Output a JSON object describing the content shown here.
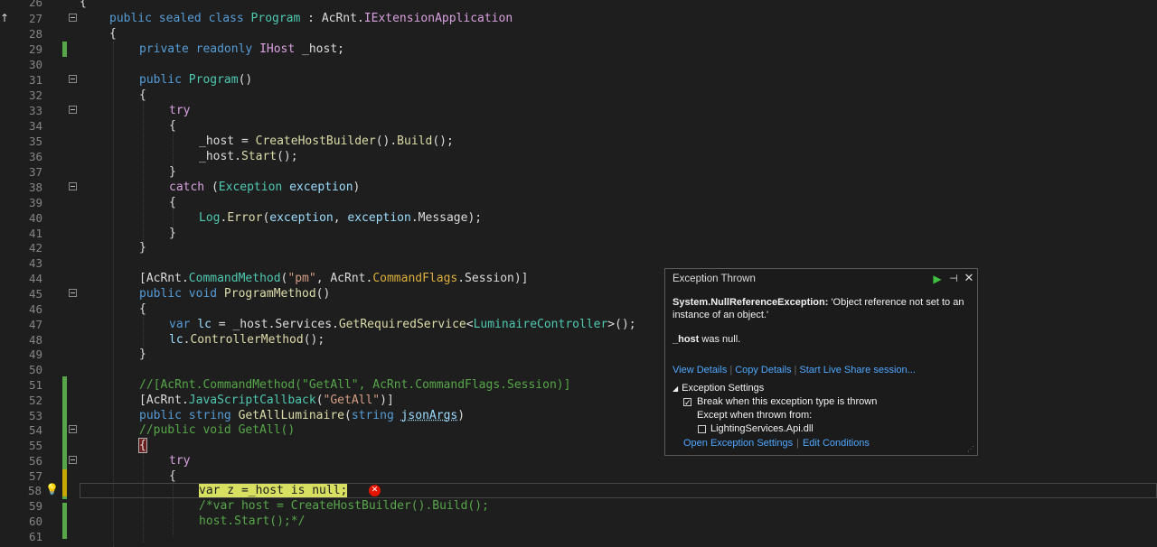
{
  "gutter": {
    "line_numbers": [
      "26",
      "27",
      "28",
      "29",
      "30",
      "31",
      "32",
      "33",
      "34",
      "35",
      "36",
      "37",
      "38",
      "39",
      "40",
      "41",
      "42",
      "43",
      "44",
      "45",
      "46",
      "47",
      "48",
      "49",
      "50",
      "51",
      "52",
      "53",
      "54",
      "55",
      "56",
      "57",
      "58",
      "59",
      "60",
      "61"
    ]
  },
  "code": {
    "l26": "{",
    "l27_kw1": "public sealed class ",
    "l27_cls": "Program",
    "l27_p": " : AcRnt.",
    "l27_iface": "IExtensionApplication",
    "l28": "{",
    "l29_kw": "private readonly ",
    "l29_iface": "IHost",
    "l29_rest": " _host;",
    "l31_kw": "public ",
    "l31_cls": "Program",
    "l31_rest": "()",
    "l32": "{",
    "l33_ctl": "try",
    "l34": "{",
    "l35_a": "_host = ",
    "l35_mt1": "CreateHostBuilder",
    "l35_b": "().",
    "l35_mt2": "Build",
    "l35_c": "();",
    "l36_a": "_host.",
    "l36_mt": "Start",
    "l36_b": "();",
    "l37": "}",
    "l38_ctl": "catch",
    "l38_a": " (",
    "l38_cls": "Exception",
    "l38_b": " ",
    "l38_par": "exception",
    "l38_c": ")",
    "l39": "{",
    "l40_cls": "Log",
    "l40_a": ".",
    "l40_mt": "Error",
    "l40_b": "(",
    "l40_par1": "exception",
    "l40_c": ", ",
    "l40_par2": "exception",
    "l40_d": ".Message);",
    "l41": "}",
    "l42": "}",
    "l44_a": "[AcRnt.",
    "l44_cls": "CommandMethod",
    "l44_b": "(",
    "l44_str": "\"pm\"",
    "l44_c": ", AcRnt.",
    "l44_enum": "CommandFlags",
    "l44_d": ".Session)]",
    "l45_kw": "public void ",
    "l45_mt": "ProgramMethod",
    "l45_rest": "()",
    "l46": "{",
    "l47_kw": "var ",
    "l47_par": "lc",
    "l47_a": " = _host.Services.",
    "l47_mt": "GetRequiredService",
    "l47_b": "<",
    "l47_cls": "LuminaireController",
    "l47_c": ">();",
    "l48_par": "lc",
    "l48_a": ".",
    "l48_mt": "ControllerMethod",
    "l48_b": "();",
    "l49": "}",
    "l51": "//[AcRnt.CommandMethod(\"GetAll\", AcRnt.CommandFlags.Session)]",
    "l52_a": "[AcRnt.",
    "l52_cls": "JavaScriptCallback",
    "l52_b": "(",
    "l52_str": "\"GetAll\"",
    "l52_c": ")]",
    "l53_kw": "public string ",
    "l53_mt": "GetAllLuminaire",
    "l53_a": "(",
    "l53_kw2": "string ",
    "l53_par": "jsonArgs",
    "l53_b": ")",
    "l54": "//public void GetAll()",
    "l55": "{",
    "l56_ctl": "try",
    "l57": "{",
    "l58": "var z =_host is null;",
    "l59": "/*var host = CreateHostBuilder().Build();",
    "l60": "host.Start();*/"
  },
  "exception_popup": {
    "title": "Exception Thrown",
    "exception_type": "System.NullReferenceException:",
    "exception_message": " 'Object reference not set to an instance of an object.'",
    "null_var": "_host",
    "null_suffix": " was null.",
    "links": [
      "View Details",
      "Copy Details",
      "Start Live Share session..."
    ],
    "settings_header": "Exception Settings",
    "break_label": "Break when this exception type is thrown",
    "break_checked": true,
    "except_label": "Except when thrown from:",
    "module_label": "LightingServices.Api.dll",
    "module_checked": false,
    "bottom_links": [
      "Open Exception Settings",
      "Edit Conditions"
    ]
  }
}
